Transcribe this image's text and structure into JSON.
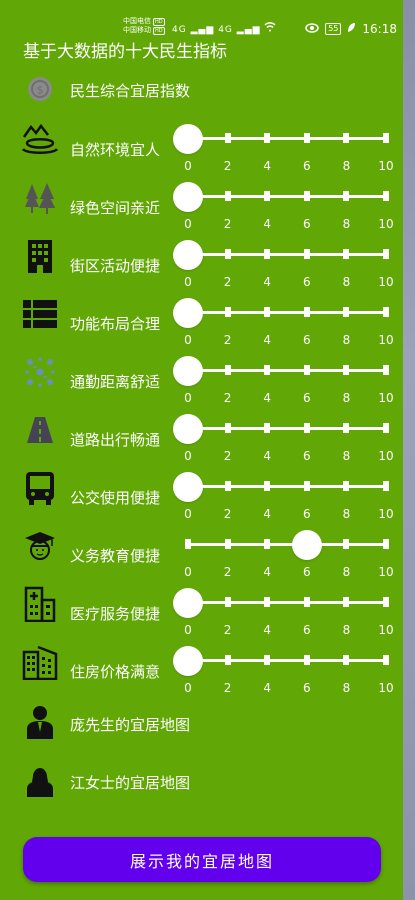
{
  "status_bar": {
    "carrier1": "中国电信",
    "carrier2": "中国移动",
    "badge": "HD",
    "network": "4G",
    "battery": "55",
    "time": "16:18"
  },
  "page_title": "基于大数据的十大民生指标",
  "index_row": {
    "label": "民生综合宜居指数",
    "icon": "coin-icon"
  },
  "slider_ticks": [
    "0",
    "2",
    "4",
    "6",
    "8",
    "10"
  ],
  "indicators": [
    {
      "label": "自然环境宜人",
      "icon": "landscape-icon",
      "value": 0
    },
    {
      "label": "绿色空间亲近",
      "icon": "trees-icon",
      "value": 0
    },
    {
      "label": "街区活动便捷",
      "icon": "building-icon",
      "value": 0
    },
    {
      "label": "功能布局合理",
      "icon": "list-icon",
      "value": 0
    },
    {
      "label": "通勤距离舒适",
      "icon": "network-icon",
      "value": 0
    },
    {
      "label": "道路出行畅通",
      "icon": "road-icon",
      "value": 0
    },
    {
      "label": "公交使用便捷",
      "icon": "bus-icon",
      "value": 0
    },
    {
      "label": "义务教育便捷",
      "icon": "graduate-icon",
      "value": 6
    },
    {
      "label": "医疗服务便捷",
      "icon": "hospital-icon",
      "value": 0
    },
    {
      "label": "住房价格满意",
      "icon": "apartments-icon",
      "value": 0
    }
  ],
  "maps": [
    {
      "label": "庞先生的宜居地图",
      "icon": "man-icon"
    },
    {
      "label": "江女士的宜居地图",
      "icon": "woman-icon"
    }
  ],
  "show_button_label": "展示我的宜居地图"
}
